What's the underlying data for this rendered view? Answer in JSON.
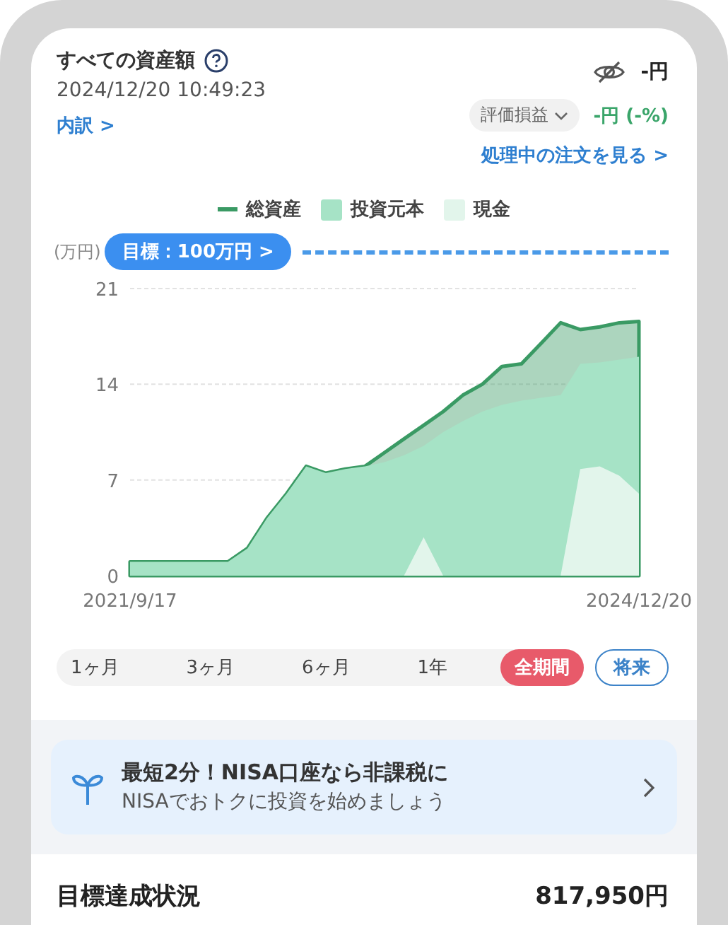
{
  "header": {
    "title": "すべての資産額",
    "timestamp": "2024/12/20 10:49:23",
    "breakdown_link": "内訳 >",
    "amount": "-円",
    "profit_selector": "評価損益",
    "profit_value": "-円 (-%)",
    "orders_link": "処理中の注文を見る >"
  },
  "legend": [
    {
      "kind": "line"
    },
    {
      "kind": "area"
    },
    {
      "kind": "area"
    }
  ],
  "goal_badge": "目標：100万円 >",
  "chart_data": {
    "type": "area",
    "ylabel": "(万円)",
    "categories": [
      "2021/9/17",
      null,
      null,
      null,
      null,
      null,
      null,
      null,
      null,
      null,
      null,
      null,
      null,
      null,
      null,
      null,
      null,
      null,
      null,
      null,
      null,
      null,
      null,
      null,
      null,
      null,
      "2024/12/20"
    ],
    "ylim": [
      0,
      21
    ],
    "yticks": [
      0,
      7,
      14,
      21
    ],
    "series": [
      {
        "name": "総資産",
        "color": "#3a9a64",
        "values": [
          1,
          1,
          1,
          1,
          1,
          1,
          2,
          4.2,
          6,
          8,
          7.5,
          7.8,
          8,
          9,
          10,
          11,
          12,
          13.2,
          14,
          15.3,
          15.5,
          17,
          18.5,
          18,
          18.2,
          18.5,
          18.6
        ]
      },
      {
        "name": "投資元本",
        "color": "#a6e3c6",
        "values": [
          1,
          1,
          1,
          1,
          1,
          1,
          2,
          4.2,
          6,
          8,
          7.5,
          7.8,
          8,
          8.3,
          8.8,
          9.5,
          10.5,
          11.3,
          12,
          12.5,
          12.8,
          13,
          13.2,
          15.5,
          15.6,
          15.8,
          16
        ]
      },
      {
        "name": "現金",
        "color": "#e2f5eb",
        "values": [
          0,
          0,
          0,
          0,
          0,
          0,
          0,
          0,
          0,
          0,
          0,
          0,
          0,
          0,
          0,
          2.8,
          0,
          0,
          0,
          0,
          0,
          0,
          0,
          7.8,
          8,
          7.3,
          6
        ]
      }
    ]
  },
  "periods": [
    {
      "label": "1ヶ月",
      "selected": false
    },
    {
      "label": "3ヶ月",
      "selected": false
    },
    {
      "label": "6ヶ月",
      "selected": false
    },
    {
      "label": "1年",
      "selected": false
    },
    {
      "label": "全期間",
      "selected": true
    }
  ],
  "future_button": "将来",
  "banner": {
    "title": "最短2分！NISA口座なら非課税に",
    "subtitle": "NISAでおトクに投資を始めましょう"
  },
  "goal_section": {
    "title": "目標達成状況",
    "amount": "817,950円"
  }
}
